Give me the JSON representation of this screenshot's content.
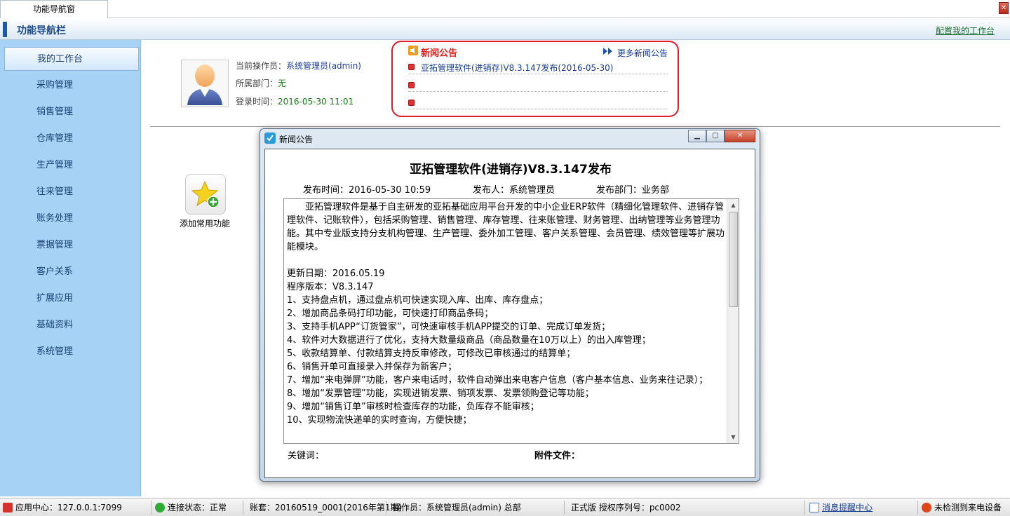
{
  "tab": {
    "label": "功能导航窗"
  },
  "nav_header": {
    "title": "功能导航栏",
    "config_link": "配置我的工作台"
  },
  "sidebar": {
    "items": [
      {
        "label": "我的工作台"
      },
      {
        "label": "采购管理"
      },
      {
        "label": "销售管理"
      },
      {
        "label": "仓库管理"
      },
      {
        "label": "生产管理"
      },
      {
        "label": "往来管理"
      },
      {
        "label": "账务处理"
      },
      {
        "label": "票据管理"
      },
      {
        "label": "客户关系"
      },
      {
        "label": "扩展应用"
      },
      {
        "label": "基础资料"
      },
      {
        "label": "系统管理"
      }
    ]
  },
  "user_info": {
    "operator_label": "当前操作员：",
    "operator_value": "系统管理员(admin)",
    "dept_label": "所属部门：",
    "dept_value": "无",
    "login_label": "登录时间：",
    "login_value": "2016-05-30 11:01"
  },
  "news": {
    "title": "新闻公告",
    "more": "更多新闻公告",
    "items": [
      "亚拓管理软件(进销存)V8.3.147发布(2016-05-30)"
    ]
  },
  "add_favorite": {
    "label": "添加常用功能"
  },
  "modal": {
    "window_title": "新闻公告",
    "heading": "亚拓管理软件(进销存)V8.3.147发布",
    "publish_time": "发布时间：2016-05-30 10:59",
    "publisher": "发布人：系统管理员",
    "department": "发布部门：业务部",
    "content": [
      "　　亚拓管理软件是基于自主研发的亚拓基础应用平台开发的中小企业ERP软件（精细化管理软件、进销存管理软件、记账软件），包括采购管理、销售管理、库存管理、往来账管理、财务管理、出纳管理等业务管理功能。其中专业版支持分支机构管理、生产管理、委外加工管理、客户关系管理、会员管理、绩效管理等扩展功能模块。",
      "",
      "更新日期：2016.05.19",
      "程序版本：V8.3.147",
      "1、支持盘点机，通过盘点机可快速实现入库、出库、库存盘点；",
      "2、增加商品条码打印功能，可快速打印商品条码；",
      "3、支持手机APP“订货管家”，可快速审核手机APP提交的订单、完成订单发货；",
      "4、软件对大数据进行了优化，支持大数量级商品（商品数量在10万以上）的出入库管理；",
      "5、收款结算单、付款结算支持反审修改，可修改已审核通过的结算单；",
      "6、销售开单可直接录入并保存为新客户；",
      "7、增加“来电弹屏”功能，客户来电话时，软件自动弹出来电客户信息（客户基本信息、业务来往记录）；",
      "8、增加“发票管理”功能，实现进销发票、销项发票、发票领购登记等功能；",
      "9、增加“销售订单”审核时检查库存的功能，负库存不能审核；",
      "10、实现物流快递单的实时查询，方便快捷；"
    ],
    "keywords_label": "关键词：",
    "attachment_label": "附件文件："
  },
  "statusbar": {
    "app_center": "应用中心：127.0.0.1:7099",
    "connection": "连接状态：正常",
    "account": "账套：20160519_0001(2016年第1期)",
    "operator": "操作员：系统管理员(admin) 总部",
    "license": "正式版 授权序列号：pc0002",
    "message": "消息提醒中心",
    "device": "未检测到来电设备"
  }
}
